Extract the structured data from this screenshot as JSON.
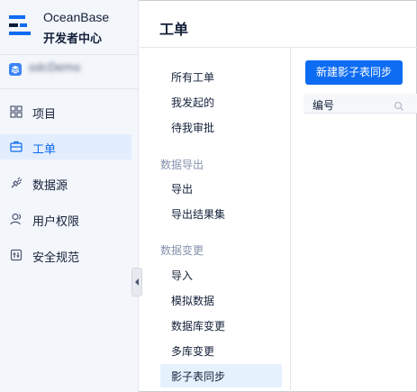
{
  "brand": {
    "name": "OceanBase",
    "subtitle": "开发者中心"
  },
  "organization": {
    "name": "odcDemo"
  },
  "sidebar": {
    "items": [
      {
        "label": "项目",
        "icon": "grid-icon"
      },
      {
        "label": "工单",
        "icon": "ticket-icon"
      },
      {
        "label": "数据源",
        "icon": "plug-icon"
      },
      {
        "label": "用户权限",
        "icon": "users-icon"
      },
      {
        "label": "安全规范",
        "icon": "shield-icon"
      }
    ]
  },
  "page": {
    "title": "工单"
  },
  "subnav": {
    "items": [
      {
        "label": "所有工单"
      },
      {
        "label": "我发起的"
      },
      {
        "label": "待我审批"
      }
    ],
    "groups": [
      {
        "title": "数据导出",
        "items": [
          {
            "label": "导出"
          },
          {
            "label": "导出结果集"
          }
        ]
      },
      {
        "title": "数据变更",
        "items": [
          {
            "label": "导入"
          },
          {
            "label": "模拟数据"
          },
          {
            "label": "数据库变更"
          },
          {
            "label": "多库变更"
          },
          {
            "label": "影子表同步"
          }
        ]
      }
    ]
  },
  "toolbar": {
    "create_label": "新建影子表同步"
  },
  "table": {
    "columns": [
      "编号"
    ]
  },
  "colors": {
    "accent": "#0d6cf2",
    "active_bg": "#e2edfd",
    "sidebar_bg": "#f3f6fb"
  }
}
